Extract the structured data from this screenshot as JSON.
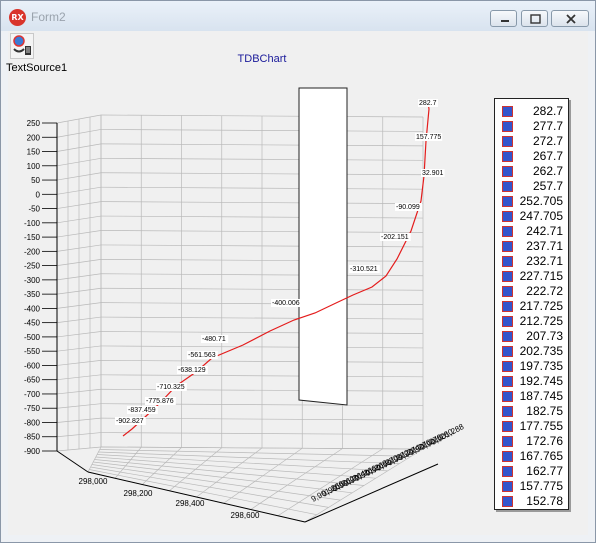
{
  "window": {
    "title": "Form2",
    "app_icon_text": "RX"
  },
  "component": {
    "label": "TextSource1",
    "icon": "datasource-icon"
  },
  "chart_data": {
    "type": "line",
    "title": "TDBChart",
    "y_ticks": [
      "250",
      "200",
      "150",
      "100",
      "50",
      "0",
      "-50",
      "-100",
      "-150",
      "-200",
      "-250",
      "-300",
      "-350",
      "-400",
      "-450",
      "-500",
      "-550",
      "-600",
      "-650",
      "-700",
      "-750",
      "-800",
      "-850",
      "-900"
    ],
    "x_ticks": [
      "298,000",
      "298,200",
      "298,400",
      "298,600"
    ],
    "z_ticks_endpoints": [
      "9,901,288",
      "9,901,258"
    ],
    "point_labels": [
      "282.7",
      "157.775",
      "32.901",
      "-90.099",
      "-202.151",
      "-310.521",
      "-400.006",
      "-480.71",
      "-561.563",
      "-638.129",
      "-710.325",
      "-775.876",
      "-837.459",
      "-902.827"
    ],
    "legend": [
      "282.7",
      "277.7",
      "272.7",
      "267.7",
      "262.7",
      "257.7",
      "252.705",
      "247.705",
      "242.71",
      "237.71",
      "232.71",
      "227.715",
      "222.72",
      "217.725",
      "212.725",
      "207.73",
      "202.735",
      "197.735",
      "192.745",
      "187.745",
      "182.75",
      "177.755",
      "172.76",
      "167.765",
      "162.77",
      "157.775",
      "152.78"
    ],
    "series_color": "#e41c1c",
    "legend_swatch_color": "#3355cc",
    "grid": true
  }
}
